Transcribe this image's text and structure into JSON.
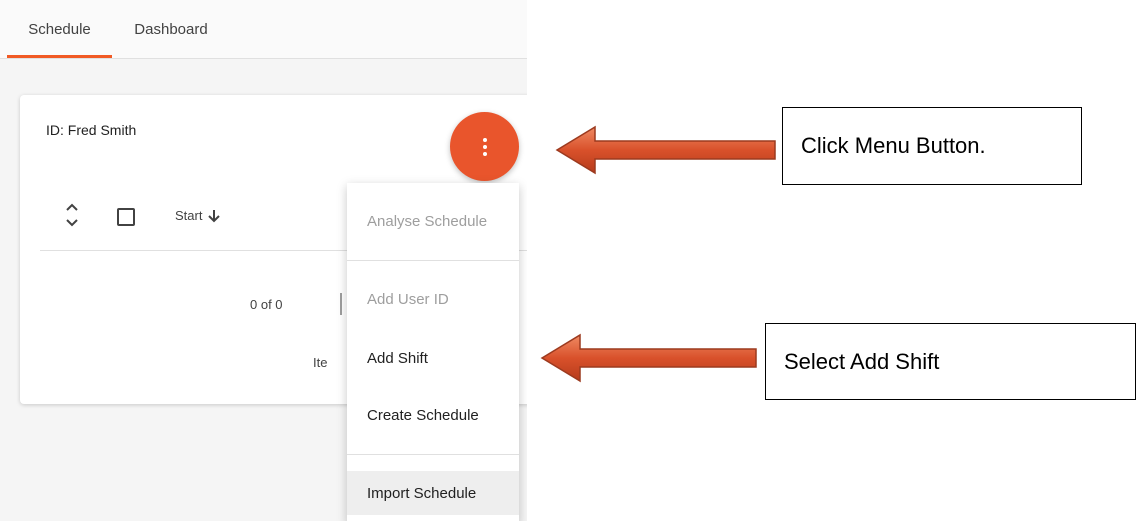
{
  "tabs": [
    {
      "label": "Schedule"
    },
    {
      "label": "Dashboard"
    }
  ],
  "card": {
    "id_label": "ID: Fred Smith",
    "table": {
      "start_header": "Start"
    },
    "pager": {
      "count": "0 of 0",
      "items_label": "Ite"
    }
  },
  "menu": {
    "items": [
      {
        "label": "Analyse Schedule"
      },
      {
        "label": "Add User ID"
      },
      {
        "label": "Add Shift"
      },
      {
        "label": "Create Schedule"
      },
      {
        "label": "Import Schedule"
      }
    ]
  },
  "annotations": {
    "callout_1": "Click Menu Button.",
    "callout_2": "Select Add Shift"
  },
  "colors": {
    "accent": "#e9552c",
    "tab_indicator": "#f15a24",
    "arrow_fill": "#d9512b"
  },
  "icons": {
    "fab": "more-vertical-icon",
    "sort": "unfold-icon",
    "start_sort": "arrow-down-icon"
  }
}
